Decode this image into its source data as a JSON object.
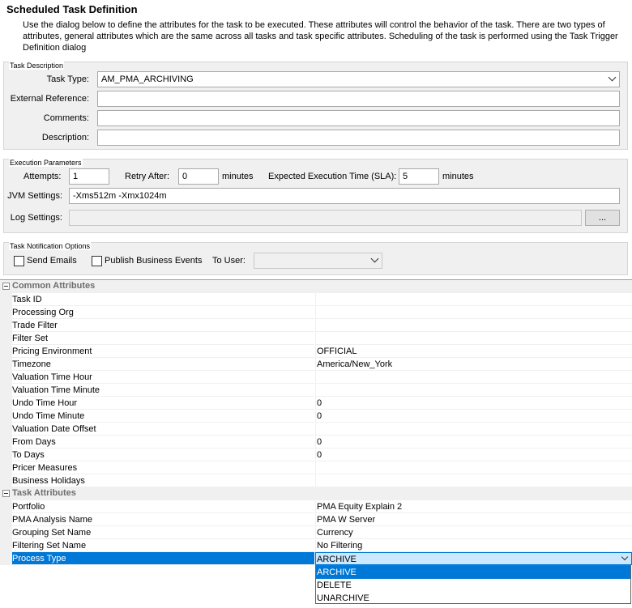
{
  "dialog": {
    "title": "Scheduled Task Definition",
    "description": "Use the dialog below to define the attributes for the task to be executed.  These attributes will control the behavior of the task.  There are two types of attributes, general attributes which are the same across all tasks and task specific attributes.  Scheduling of the task is performed using the Task Trigger Definition dialog"
  },
  "task_description": {
    "group_title": "Task Description",
    "task_type_label": "Task Type:",
    "task_type_value": "AM_PMA_ARCHIVING",
    "external_reference_label": "External Reference:",
    "external_reference_value": "",
    "comments_label": "Comments:",
    "comments_value": "",
    "description_label": "Description:",
    "description_value": ""
  },
  "execution": {
    "group_title": "Execution Parameters",
    "attempts_label": "Attempts:",
    "attempts_value": "1",
    "retry_label": "Retry After:",
    "retry_value": "0",
    "retry_unit": "minutes",
    "expected_label": "Expected Execution Time (SLA):",
    "expected_value": "5",
    "expected_unit": "minutes",
    "jvm_label": "JVM Settings:",
    "jvm_value": "-Xms512m -Xmx1024m",
    "log_label": "Log Settings:",
    "log_value": "",
    "browse_label": "..."
  },
  "notification": {
    "group_title": "Task Notification Options",
    "send_emails_label": "Send Emails",
    "send_emails_checked": false,
    "publish_label": "Publish Business Events",
    "publish_checked": false,
    "to_user_label": "To User:",
    "to_user_value": ""
  },
  "grid": {
    "common": {
      "title": "Common Attributes",
      "rows": [
        {
          "name": "Task ID",
          "value": ""
        },
        {
          "name": "Processing Org",
          "value": ""
        },
        {
          "name": "Trade Filter",
          "value": ""
        },
        {
          "name": "Filter Set",
          "value": ""
        },
        {
          "name": "Pricing Environment",
          "value": "OFFICIAL"
        },
        {
          "name": "Timezone",
          "value": "America/New_York"
        },
        {
          "name": "Valuation Time Hour",
          "value": ""
        },
        {
          "name": "Valuation Time Minute",
          "value": ""
        },
        {
          "name": "Undo Time Hour",
          "value": "0"
        },
        {
          "name": "Undo Time Minute",
          "value": "0"
        },
        {
          "name": "Valuation Date Offset",
          "value": ""
        },
        {
          "name": "From Days",
          "value": "0"
        },
        {
          "name": "To Days",
          "value": "0"
        },
        {
          "name": "Pricer Measures",
          "value": ""
        },
        {
          "name": "Business Holidays",
          "value": ""
        }
      ]
    },
    "task": {
      "title": "Task Attributes",
      "rows": [
        {
          "name": "Portfolio",
          "value": "PMA Equity Explain 2"
        },
        {
          "name": "PMA Analysis Name",
          "value": "PMA W Server"
        },
        {
          "name": "Grouping Set Name",
          "value": "Currency"
        },
        {
          "name": "Filtering Set Name",
          "value": "No Filtering"
        },
        {
          "name": "Process Type",
          "value": "ARCHIVE"
        }
      ]
    },
    "process_type_options": [
      "ARCHIVE",
      "DELETE",
      "UNARCHIVE"
    ],
    "process_type_selected": "ARCHIVE"
  }
}
